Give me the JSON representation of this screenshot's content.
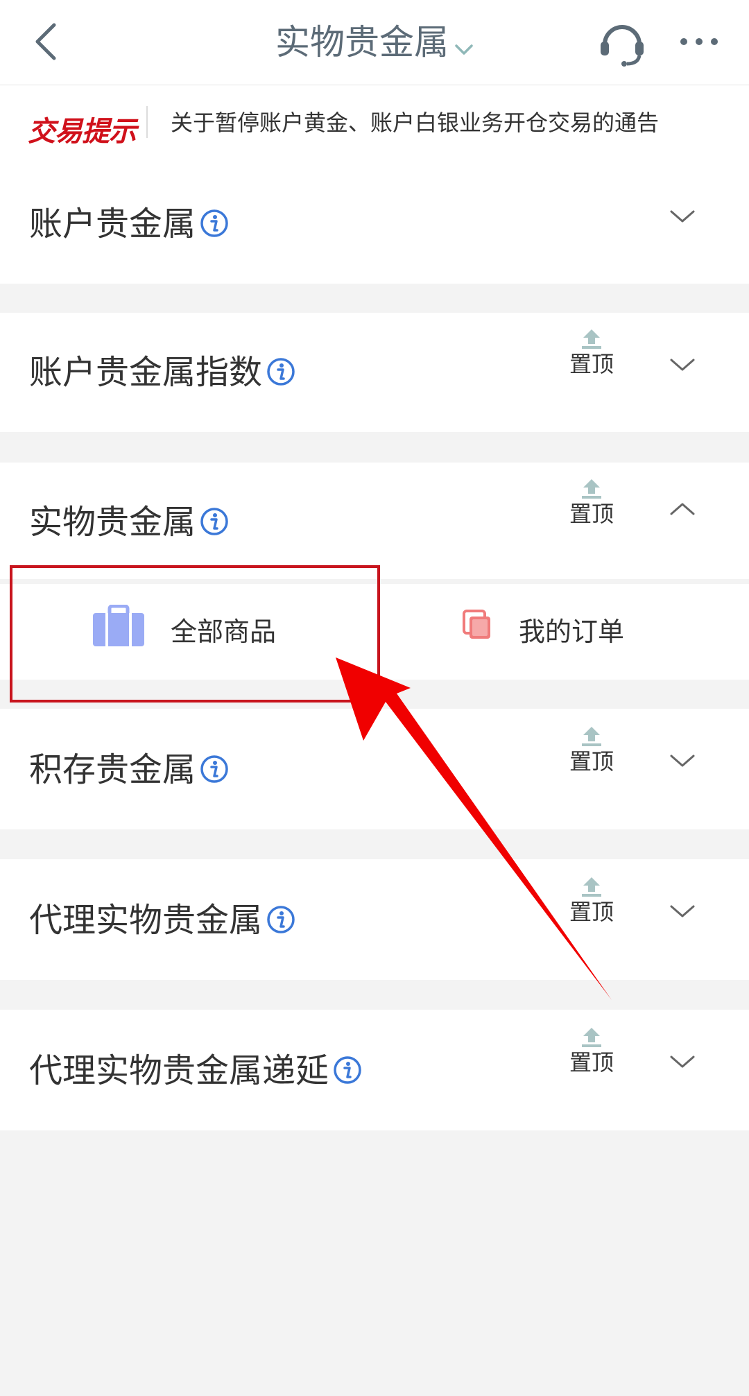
{
  "header": {
    "title": "实物贵金属",
    "back_icon": "chevron-left-icon",
    "service_icon": "headset-icon",
    "more_icon": "more-dots-icon"
  },
  "notice": {
    "tag": "交易提示",
    "text": "关于暂停账户黄金、账户白银业务开仓交易的通告"
  },
  "sections": [
    {
      "title": "账户贵金属",
      "pin_label": "",
      "expanded": false
    },
    {
      "title": "账户贵金属指数",
      "pin_label": "置顶",
      "expanded": false
    },
    {
      "title": "实物贵金属",
      "pin_label": "置顶",
      "expanded": true
    },
    {
      "title": "积存贵金属",
      "pin_label": "置顶",
      "expanded": false
    },
    {
      "title": "代理实物贵金属",
      "pin_label": "置顶",
      "expanded": false
    },
    {
      "title": "代理实物贵金属递延",
      "pin_label": "置顶",
      "expanded": false
    }
  ],
  "sub_items": [
    {
      "label": "全部商品",
      "icon": "briefcase-icon"
    },
    {
      "label": "我的订单",
      "icon": "orders-icon"
    }
  ],
  "colors": {
    "accent_red": "#d0111b",
    "info_blue": "#3b78d8",
    "briefcase": "#9aabf5",
    "orders": "#f07b7b",
    "pin_icon": "#a9c4c4",
    "annotation_red": "#f00000"
  }
}
